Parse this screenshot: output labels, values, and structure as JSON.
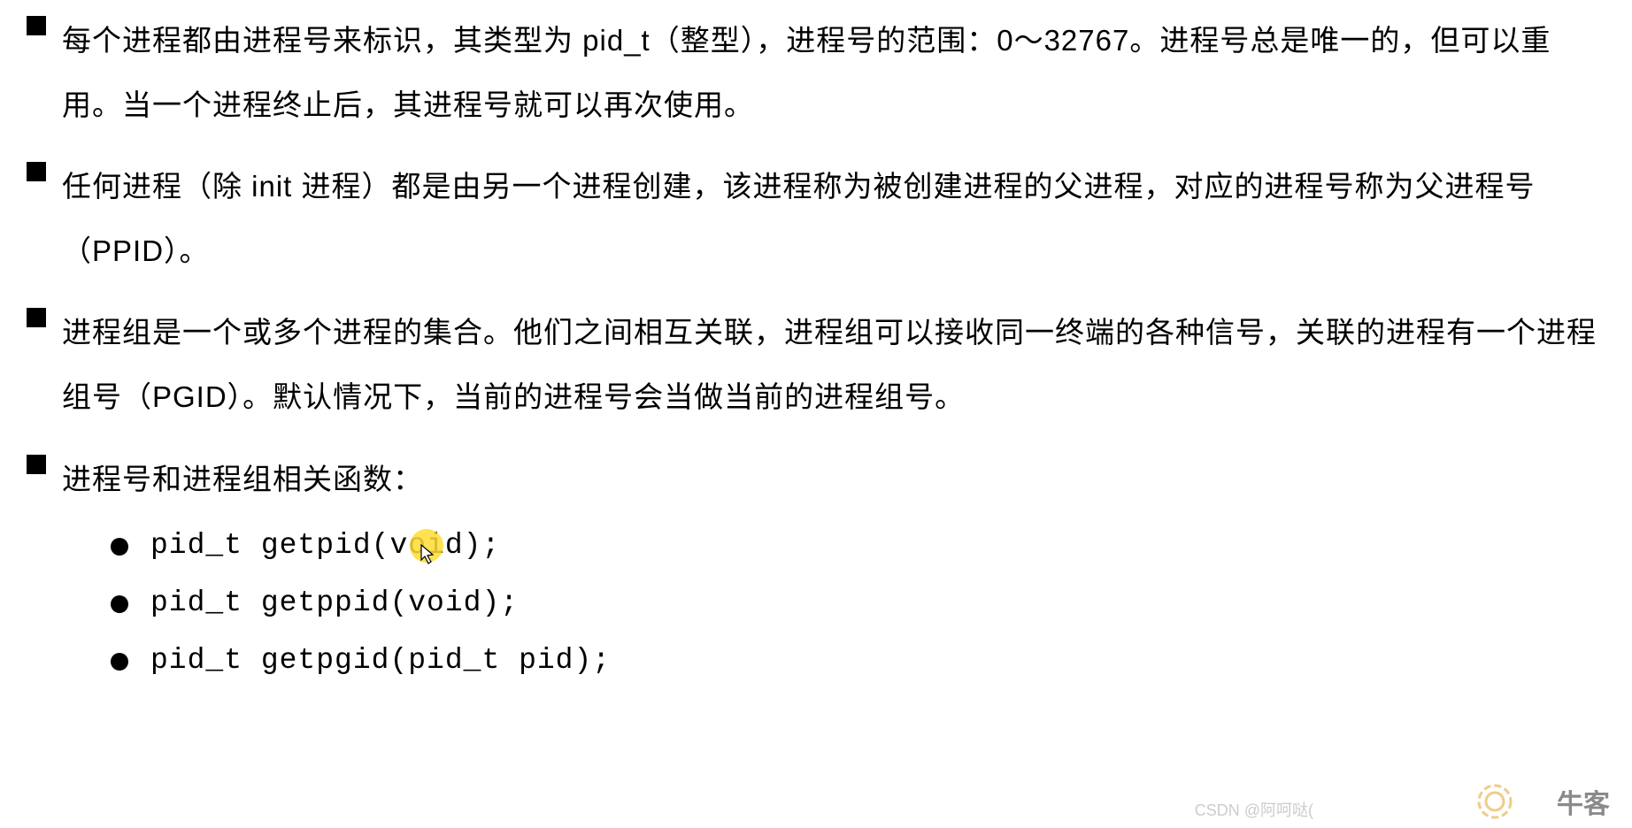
{
  "bullets": [
    {
      "text": "每个进程都由进程号来标识，其类型为 pid_t（整型），进程号的范围：0～32767。进程号总是唯一的，但可以重用。当一个进程终止后，其进程号就可以再次使用。"
    },
    {
      "text": "任何进程（除 init 进程）都是由另一个进程创建，该进程称为被创建进程的父进程，对应的进程号称为父进程号（PPID）。"
    },
    {
      "text": "进程组是一个或多个进程的集合。他们之间相互关联，进程组可以接收同一终端的各种信号，关联的进程有一个进程组号（PGID）。默认情况下，当前的进程号会当做当前的进程组号。"
    },
    {
      "text": "进程号和进程组相关函数：",
      "subs": [
        "pid_t getpid(void);",
        "pid_t getppid(void);",
        "pid_t getpgid(pid_t pid);"
      ]
    }
  ],
  "watermarks": {
    "csdn": "CSDN @阿呵哒(",
    "niuke": "牛客"
  }
}
